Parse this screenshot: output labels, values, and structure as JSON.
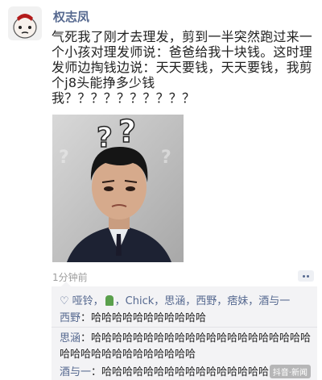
{
  "post": {
    "author": "权志凤",
    "text_lines": [
      "气死我了刚才去理发，剪到一半突然跑过来一",
      "个小孩对理发师说：爸爸给我十块钱。这时理",
      "发师边掏钱边说：天天要钱，天天要钱，我剪",
      "个j8头能挣多少钱",
      "我？？？？？？？？？？"
    ],
    "time": "1分钟前"
  },
  "likes": {
    "line1": "哑铃，",
    "line2": "，Chick，思涵",
    "line3": "，西野",
    "line4": "，痞妹，酒与一",
    "line5": "西野",
    "line6": "：哈哈哈哈哈哈哈哈哈哈哈"
  },
  "comments": [
    {
      "name": "思涵",
      "text": "：哈哈哈哈哈哈哈哈哈哈哈哈哈哈哈哈哈哈哈哈哈哈哈哈哈哈哈哈哈哈哈哈哈哈"
    },
    {
      "name": "酒与一",
      "text": "：哈哈哈哈哈哈哈哈哈哈哈哈哈哈哈哈"
    }
  ],
  "watermark": "抖音·新闻"
}
